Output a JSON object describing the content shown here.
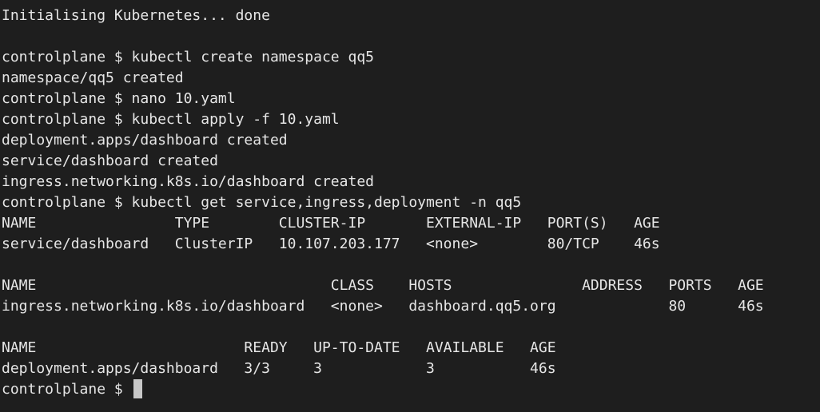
{
  "terminal": {
    "lines": [
      "Initialising Kubernetes... done",
      "",
      "controlplane $ kubectl create namespace qq5",
      "namespace/qq5 created",
      "controlplane $ nano 10.yaml",
      "controlplane $ kubectl apply -f 10.yaml",
      "deployment.apps/dashboard created",
      "service/dashboard created",
      "ingress.networking.k8s.io/dashboard created",
      "controlplane $ kubectl get service,ingress,deployment -n qq5",
      "NAME                TYPE        CLUSTER-IP       EXTERNAL-IP   PORT(S)   AGE",
      "service/dashboard   ClusterIP   10.107.203.177   <none>        80/TCP    46s",
      "",
      "NAME                                  CLASS    HOSTS               ADDRESS   PORTS   AGE",
      "ingress.networking.k8s.io/dashboard   <none>   dashboard.qq5.org             80      46s",
      "",
      "NAME                        READY   UP-TO-DATE   AVAILABLE   AGE",
      "deployment.apps/dashboard   3/3     3            3           46s"
    ],
    "prompt": "controlplane $ "
  }
}
